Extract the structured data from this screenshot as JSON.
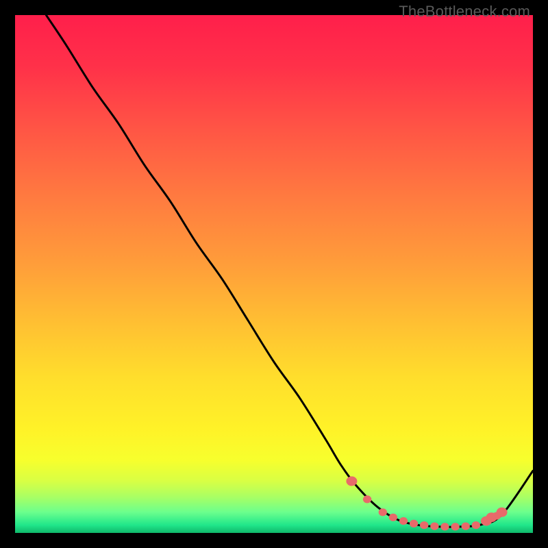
{
  "watermark": "TheBottleneck.com",
  "chart_data": {
    "type": "line",
    "title": "",
    "xlabel": "",
    "ylabel": "",
    "xlim": [
      0,
      100
    ],
    "ylim": [
      0,
      100
    ],
    "grid": false,
    "series": [
      {
        "name": "curve",
        "x": [
          6,
          10,
          15,
          20,
          25,
          30,
          35,
          40,
          45,
          50,
          55,
          60,
          63,
          66,
          70,
          74,
          78,
          82,
          86,
          90,
          94,
          100
        ],
        "y": [
          100,
          94,
          86,
          79,
          71,
          64,
          56,
          49,
          41,
          33,
          26,
          18,
          13,
          9,
          5,
          2.5,
          1.5,
          1.2,
          1.2,
          1.6,
          3.5,
          12
        ]
      }
    ],
    "markers": {
      "color": "#e86a6a",
      "points": [
        {
          "x": 65,
          "y": 10
        },
        {
          "x": 68,
          "y": 6.5
        },
        {
          "x": 71,
          "y": 4
        },
        {
          "x": 73,
          "y": 3
        },
        {
          "x": 75,
          "y": 2.3
        },
        {
          "x": 77,
          "y": 1.8
        },
        {
          "x": 79,
          "y": 1.5
        },
        {
          "x": 81,
          "y": 1.3
        },
        {
          "x": 83,
          "y": 1.2
        },
        {
          "x": 85,
          "y": 1.2
        },
        {
          "x": 87,
          "y": 1.3
        },
        {
          "x": 89,
          "y": 1.5
        },
        {
          "x": 91,
          "y": 2.3
        },
        {
          "x": 92,
          "y": 3
        },
        {
          "x": 93,
          "y": 3.3
        },
        {
          "x": 94,
          "y": 4
        }
      ]
    },
    "gradient_stops": [
      {
        "offset": 0.0,
        "color": "#ff1f4b"
      },
      {
        "offset": 0.1,
        "color": "#ff3149"
      },
      {
        "offset": 0.22,
        "color": "#ff5545"
      },
      {
        "offset": 0.35,
        "color": "#ff7a40"
      },
      {
        "offset": 0.48,
        "color": "#ff9d3a"
      },
      {
        "offset": 0.6,
        "color": "#ffc132"
      },
      {
        "offset": 0.7,
        "color": "#ffde2c"
      },
      {
        "offset": 0.8,
        "color": "#fff228"
      },
      {
        "offset": 0.86,
        "color": "#f7ff2d"
      },
      {
        "offset": 0.9,
        "color": "#d8ff44"
      },
      {
        "offset": 0.93,
        "color": "#aaff63"
      },
      {
        "offset": 0.96,
        "color": "#6bff8d"
      },
      {
        "offset": 0.985,
        "color": "#20e68a"
      },
      {
        "offset": 1.0,
        "color": "#0fb86a"
      }
    ]
  }
}
